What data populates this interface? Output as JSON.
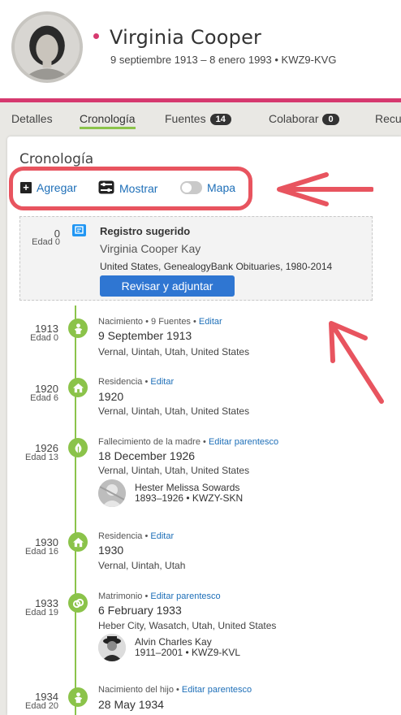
{
  "person": {
    "name": "Virginia Cooper",
    "meta": "9 septiembre 1913 – 8 enero 1993 • KWZ9-KVG"
  },
  "tabs": [
    {
      "label": "Detalles"
    },
    {
      "label": "Cronología",
      "active": true
    },
    {
      "label": "Fuentes",
      "badge": "14"
    },
    {
      "label": "Colaborar",
      "badge": "0"
    },
    {
      "label": "Recu"
    }
  ],
  "timeline": {
    "title": "Cronología",
    "toolbar": {
      "add": "Agregar",
      "show": "Mostrar",
      "map": "Mapa"
    },
    "suggested": {
      "year": "0",
      "age": "Edad 0",
      "title": "Registro sugerido",
      "name": "Virginia Cooper Kay",
      "collection": "United States, GenealogyBank Obituaries, 1980-2014",
      "button": "Revisar y adjuntar"
    },
    "events": [
      {
        "year": "1913",
        "age": "Edad 0",
        "type": "Nacimiento",
        "sources": "9 Fuentes",
        "edit": "Editar",
        "date": "9 September 1913",
        "place": "Vernal, Uintah, Utah, United States",
        "icon": "birth-icon"
      },
      {
        "year": "1920",
        "age": "Edad 6",
        "type": "Residencia",
        "edit": "Editar",
        "date": "1920",
        "place": "Vernal, Uintah, Utah, United States",
        "icon": "residence-icon"
      },
      {
        "year": "1926",
        "age": "Edad 13",
        "type": "Fallecimiento de la madre",
        "edit": "Editar parentesco",
        "date": "18 December 1926",
        "place": "Vernal, Uintah, Utah, United States",
        "icon": "death-icon",
        "relative": {
          "name": "Hester Melissa Sowards",
          "meta": "1893–1926 •  KWZY-SKN"
        }
      },
      {
        "year": "1930",
        "age": "Edad 16",
        "type": "Residencia",
        "edit": "Editar",
        "date": "1930",
        "place": "Vernal, Uintah, Utah",
        "icon": "residence-icon"
      },
      {
        "year": "1933",
        "age": "Edad 19",
        "type": "Matrimonio",
        "edit": "Editar parentesco",
        "date": "6 February 1933",
        "place": "Heber City, Wasatch, Utah, United States",
        "icon": "marriage-icon",
        "relative": {
          "name": "Alvin Charles Kay",
          "meta": "1911–2001 •  KWZ9-KVL"
        }
      },
      {
        "year": "1934",
        "age": "Edad 20",
        "type": "Nacimiento del hijo",
        "edit": "Editar parentesco",
        "date": "28 May 1934",
        "place": "",
        "icon": "birth-icon"
      }
    ]
  },
  "colors": {
    "accent": "#d6396f",
    "timeline": "#8bc34a",
    "link": "#1e6fb8",
    "button": "#2f76d2",
    "annotation": "#e8545f"
  }
}
